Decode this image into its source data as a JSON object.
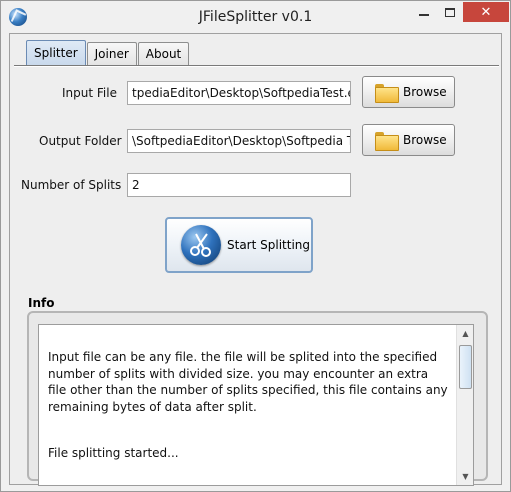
{
  "window": {
    "title": "JFileSplitter v0.1",
    "close_symbol": "✕"
  },
  "tabs": [
    {
      "label": "Splitter",
      "active": true
    },
    {
      "label": "Joiner",
      "active": false
    },
    {
      "label": "About",
      "active": false
    }
  ],
  "form": {
    "input_file_label": "Input File",
    "input_file_value": "tpediaEditor\\Desktop\\SoftpediaTest.exe",
    "output_folder_label": "Output Folder",
    "output_folder_value": "\\SoftpediaEditor\\Desktop\\Softpedia Test",
    "splits_label": "Number of Splits",
    "splits_value": "2",
    "browse_label": "Browse",
    "start_label": "Start Splitting"
  },
  "info": {
    "title": "Info",
    "description": "Input file can be any file. the file will be splited into the specified number of splits with divided size. you may encounter an extra file other than the number of splits specified, this file contains any remaining bytes of data after split.",
    "status": "File splitting started..."
  },
  "icons": {
    "app": "jfilesplitter-app-icon",
    "folder": "folder-icon",
    "scissors": "scissors-icon"
  },
  "colors": {
    "close_button": "#c7463c",
    "active_tab": "#c9d9ec",
    "scissors_icon": "#2f72bd"
  }
}
